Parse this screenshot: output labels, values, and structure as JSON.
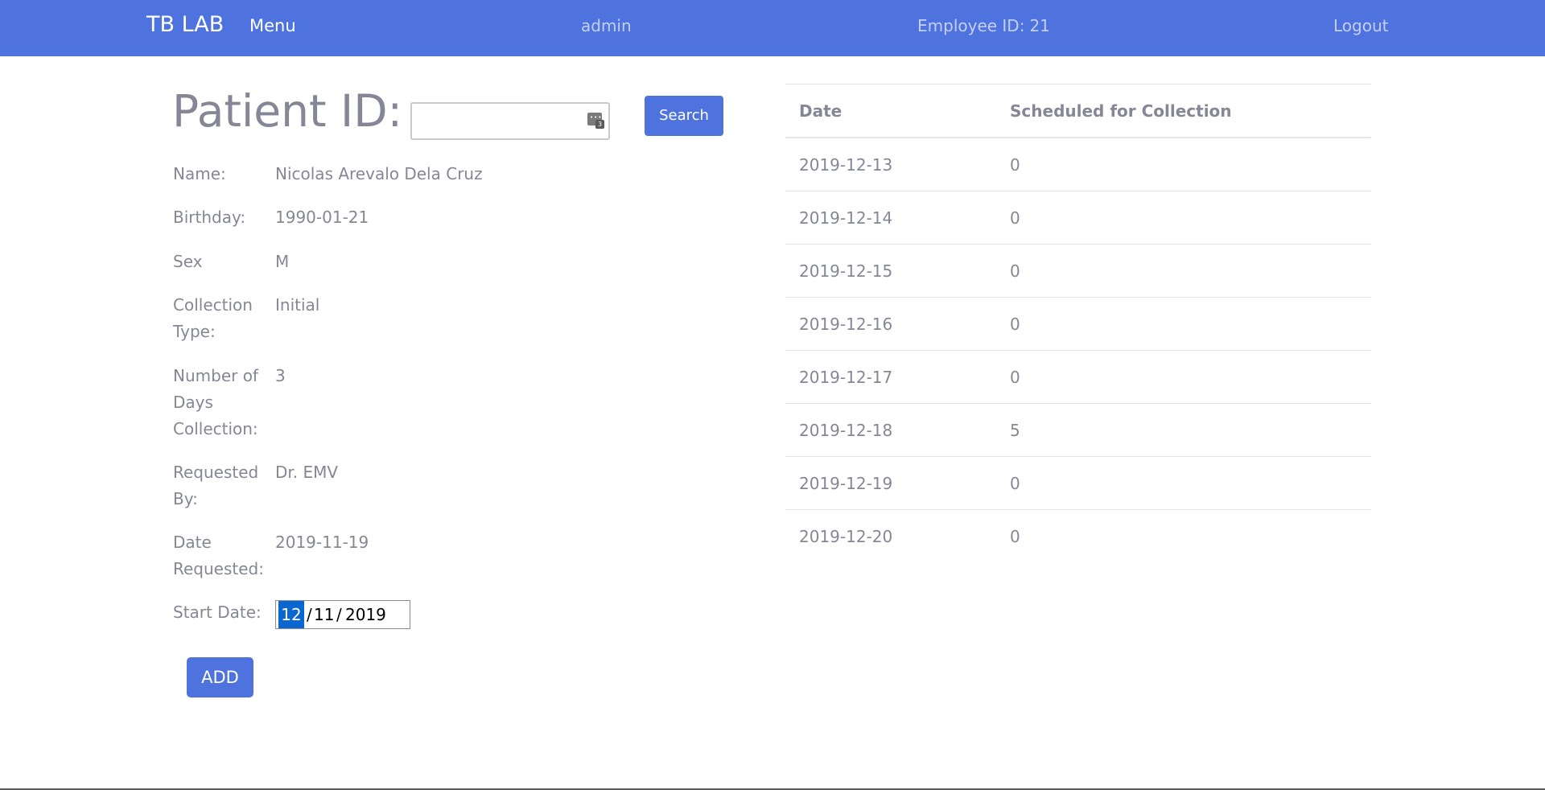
{
  "nav": {
    "brand": "TB LAB",
    "menu": "Menu",
    "user": "admin",
    "employee_label": "Employee ID:",
    "employee_id": "21",
    "logout": "Logout",
    "color": "#4e73df"
  },
  "search": {
    "label": "Patient ID:",
    "value": "",
    "button": "Search",
    "icon": "password-manager-icon",
    "icon_badge": "3"
  },
  "patient": {
    "fields": [
      {
        "label": "Name:",
        "value": "Nicolas Arevalo Dela Cruz"
      },
      {
        "label": "Birthday:",
        "value": "1990-01-21"
      },
      {
        "label": "Sex",
        "value": "M"
      },
      {
        "label": "Collection Type:",
        "value": "Initial"
      },
      {
        "label": "Number of Days Collection:",
        "value": "3"
      },
      {
        "label": "Requested By:",
        "value": "Dr. EMV"
      },
      {
        "label": "Date Requested:",
        "value": "2019-11-19"
      }
    ],
    "start_date": {
      "label": "Start Date:",
      "day": "12",
      "month": "11",
      "year": "2019",
      "separator": "/"
    },
    "add_button": "ADD"
  },
  "schedule": {
    "headers": {
      "date": "Date",
      "count": "Scheduled for Collection"
    },
    "rows": [
      {
        "date": "2019-12-13",
        "count": "0"
      },
      {
        "date": "2019-12-14",
        "count": "0"
      },
      {
        "date": "2019-12-15",
        "count": "0"
      },
      {
        "date": "2019-12-16",
        "count": "0"
      },
      {
        "date": "2019-12-17",
        "count": "0"
      },
      {
        "date": "2019-12-18",
        "count": "5"
      },
      {
        "date": "2019-12-19",
        "count": "0"
      },
      {
        "date": "2019-12-20",
        "count": "0"
      }
    ]
  }
}
